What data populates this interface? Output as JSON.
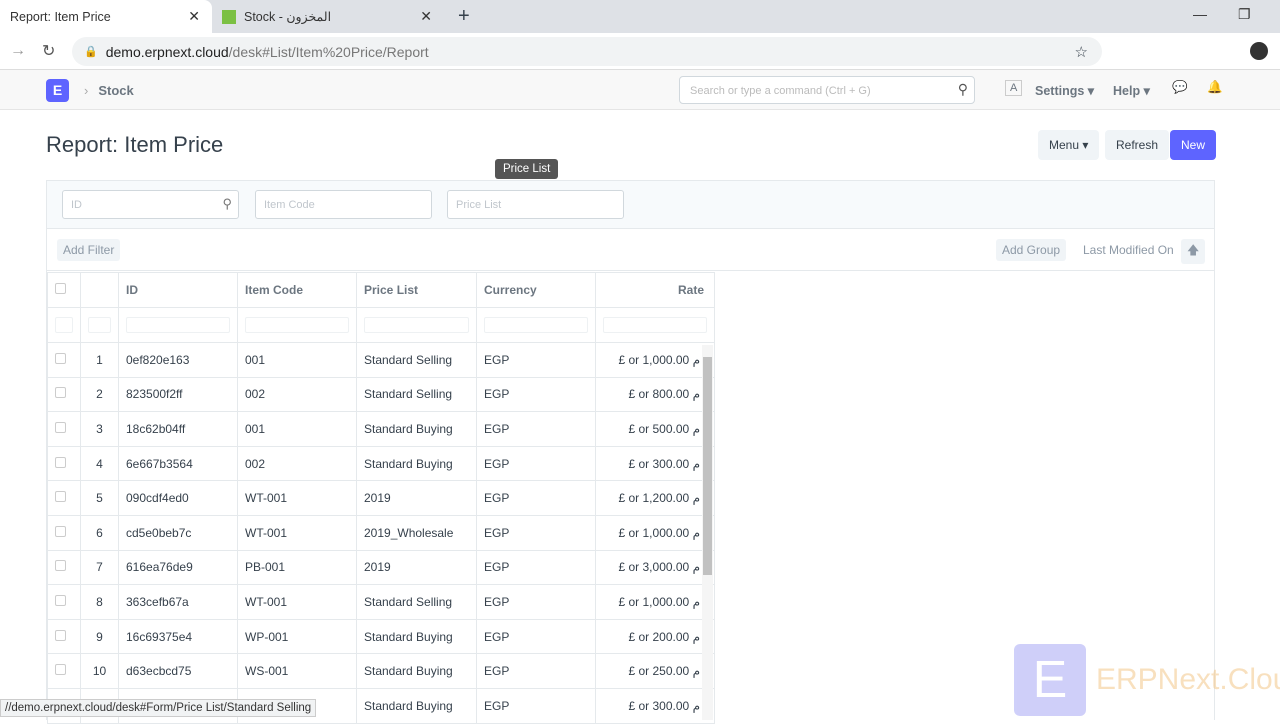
{
  "browser": {
    "tabs": [
      {
        "label": "Report: Item Price"
      },
      {
        "label": "Stock - المخزون"
      }
    ],
    "url_host": "demo.erpnext.cloud",
    "url_path": "/desk#List/Item%20Price/Report",
    "status_url": "//demo.erpnext.cloud/desk#Form/Price List/Standard Selling"
  },
  "navbar": {
    "logo": "E",
    "breadcrumb": "Stock",
    "search_placeholder": "Search or type a command (Ctrl + G)",
    "avatar": "A",
    "settings": "Settings",
    "help": "Help"
  },
  "page": {
    "title": "Report: Item Price",
    "menu": "Menu",
    "refresh": "Refresh",
    "new": "New"
  },
  "filters": {
    "id": "ID",
    "item_code": "Item Code",
    "price_list": "Price List",
    "tooltip": "Price List"
  },
  "toolbar": {
    "add_filter": "Add Filter",
    "add_group": "Add Group",
    "sort": "Last Modified On"
  },
  "table": {
    "columns": [
      "ID",
      "Item Code",
      "Price List",
      "Currency",
      "Rate"
    ],
    "rows": [
      [
        "1",
        "0ef820e163",
        "001",
        "Standard Selling",
        "EGP",
        "£ or 1,000.00 م"
      ],
      [
        "2",
        "823500f2ff",
        "002",
        "Standard Selling",
        "EGP",
        "£ or 800.00 م"
      ],
      [
        "3",
        "18c62b04ff",
        "001",
        "Standard Buying",
        "EGP",
        "£ or 500.00 م"
      ],
      [
        "4",
        "6e667b3564",
        "002",
        "Standard Buying",
        "EGP",
        "£ or 300.00 م"
      ],
      [
        "5",
        "090cdf4ed0",
        "WT-001",
        "2019",
        "EGP",
        "£ or 1,200.00 م"
      ],
      [
        "6",
        "cd5e0beb7c",
        "WT-001",
        "2019_Wholesale",
        "EGP",
        "£ or 1,000.00 م"
      ],
      [
        "7",
        "616ea76de9",
        "PB-001",
        "2019",
        "EGP",
        "£ or 3,000.00 م"
      ],
      [
        "8",
        "363cefb67a",
        "WT-001",
        "Standard Selling",
        "EGP",
        "£ or 1,000.00 م"
      ],
      [
        "9",
        "16c69375e4",
        "WP-001",
        "Standard Buying",
        "EGP",
        "£ or 200.00 م"
      ],
      [
        "10",
        "d63ecbcd75",
        "WS-001",
        "Standard Buying",
        "EGP",
        "£ or 250.00 م"
      ],
      [
        "",
        "",
        "",
        "Standard Buying",
        "EGP",
        "£ or 300.00 م"
      ]
    ]
  },
  "watermark": "ERPNext.Cloud"
}
